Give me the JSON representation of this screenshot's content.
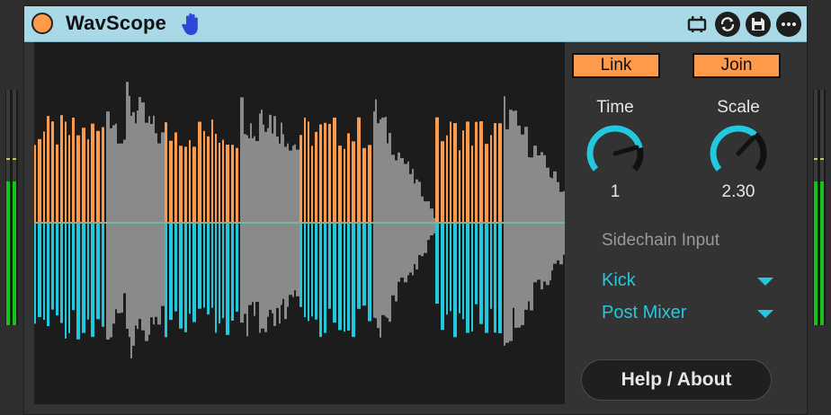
{
  "device": {
    "title": "WavScope",
    "colors": {
      "accent": "#ff9a4a",
      "titlebar": "#a9d8e6",
      "cyan": "#24c8de",
      "wave_gray": "#8a8a8a",
      "meter_green": "#17c21d"
    }
  },
  "toolbar": {
    "icons": [
      "monitor-icon",
      "refresh-icon",
      "save-icon",
      "more-icon"
    ]
  },
  "buttons": {
    "link": "Link",
    "join": "Join"
  },
  "knobs": {
    "time": {
      "label": "Time",
      "value": "1"
    },
    "scale": {
      "label": "Scale",
      "value": "2.30"
    }
  },
  "sidechain": {
    "label": "Sidechain Input",
    "source": "Kick",
    "tap": "Post Mixer"
  },
  "help": {
    "label": "Help / About"
  },
  "meters": {
    "left": {
      "level": 0.61
    },
    "right": {
      "level": 0.61
    }
  }
}
